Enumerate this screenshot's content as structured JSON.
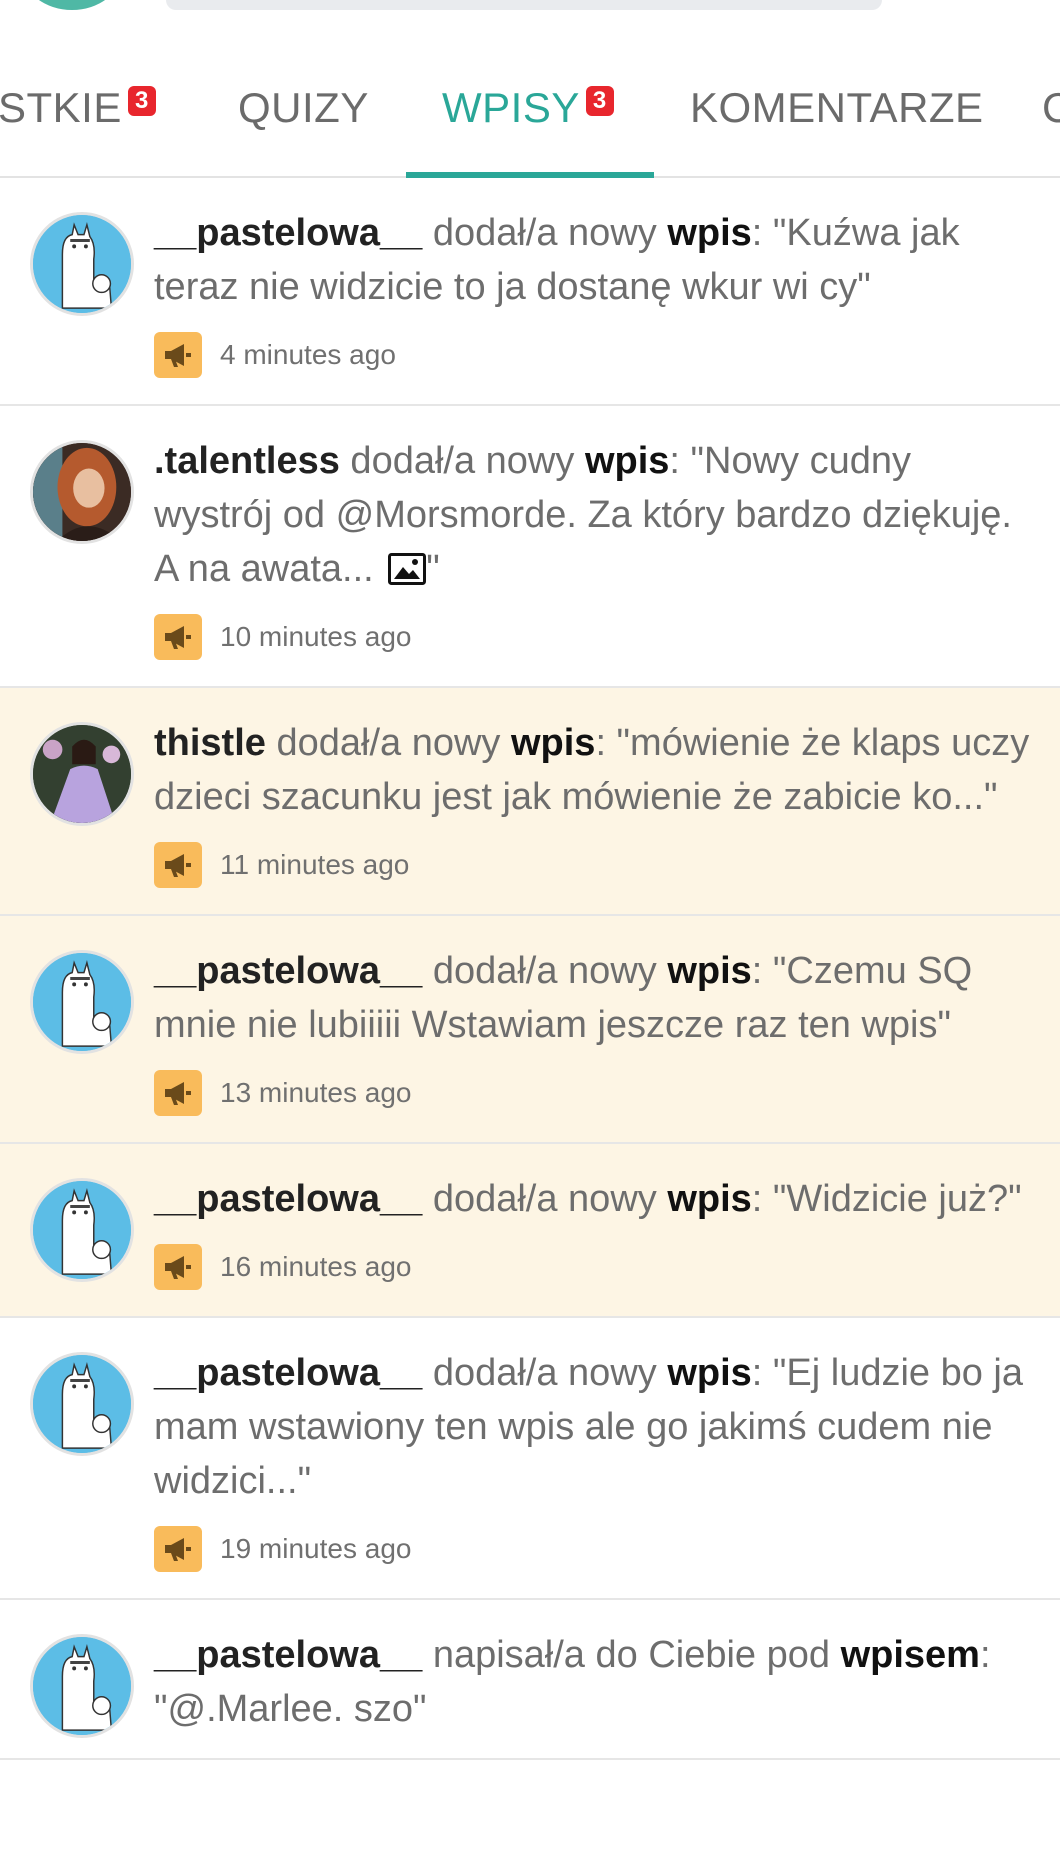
{
  "tabs": [
    {
      "label": "STKIE",
      "badge": "3",
      "active": false
    },
    {
      "label": "QUIZY",
      "badge": "",
      "active": false
    },
    {
      "label": "WPISY",
      "badge": "3",
      "active": true
    },
    {
      "label": "KOMENTARZE",
      "badge": "",
      "active": false
    },
    {
      "label": "C",
      "badge": "",
      "active": false
    }
  ],
  "colors": {
    "accent": "#2aa798",
    "badge": "#e8262d",
    "unread_bg": "#fdf5e4",
    "icon_bg": "#f9bb5b"
  },
  "feed": [
    {
      "user": "__pastelowa__",
      "action": " dodał/a nowy ",
      "keyword": "wpis",
      "content": ": \"Kuźwa jak teraz nie widzicie to ja dostanę wkur wi cy\"",
      "time": "4 minutes ago",
      "avatar": "alpaca-avatar",
      "unread": false
    },
    {
      "user": ".talentless",
      "action": " dodał/a nowy ",
      "keyword": "wpis",
      "content": ": \"Nowy cudny wystrój od @Morsmorde. Za który bardzo dziękuję. A na awata... ",
      "content_end": "\"",
      "has_image_icon": true,
      "time": "10 minutes ago",
      "avatar": "portrait-avatar",
      "unread": false
    },
    {
      "user": "thistle",
      "action": " dodał/a nowy ",
      "keyword": "wpis",
      "content": ": \"mówienie że klaps uczy dzieci szacunku jest jak mówienie że zabicie ko...\"",
      "time": "11 minutes ago",
      "avatar": "dress-avatar",
      "unread": true
    },
    {
      "user": "__pastelowa__",
      "action": " dodał/a nowy ",
      "keyword": "wpis",
      "content": ": \"Czemu SQ mnie nie lubiiiii Wstawiam jeszcze raz ten wpis\"",
      "time": "13 minutes ago",
      "avatar": "alpaca-avatar",
      "unread": true
    },
    {
      "user": "__pastelowa__",
      "action": " dodał/a nowy ",
      "keyword": "wpis",
      "content": ": \"Widzicie już?\"",
      "time": "16 minutes ago",
      "avatar": "alpaca-avatar",
      "unread": true
    },
    {
      "user": "__pastelowa__",
      "action": " dodał/a nowy ",
      "keyword": "wpis",
      "content": ": \"Ej ludzie bo ja mam wstawiony ten wpis ale go jakimś cudem nie widzici...\"",
      "time": "19 minutes ago",
      "avatar": "alpaca-avatar",
      "unread": false
    },
    {
      "user": "__pastelowa__",
      "action": " napisał/a do Ciebie pod ",
      "keyword": "wpisem",
      "content": ": \"@.Marlee. szo\"",
      "time": "",
      "avatar": "alpaca-avatar",
      "unread": false
    }
  ]
}
